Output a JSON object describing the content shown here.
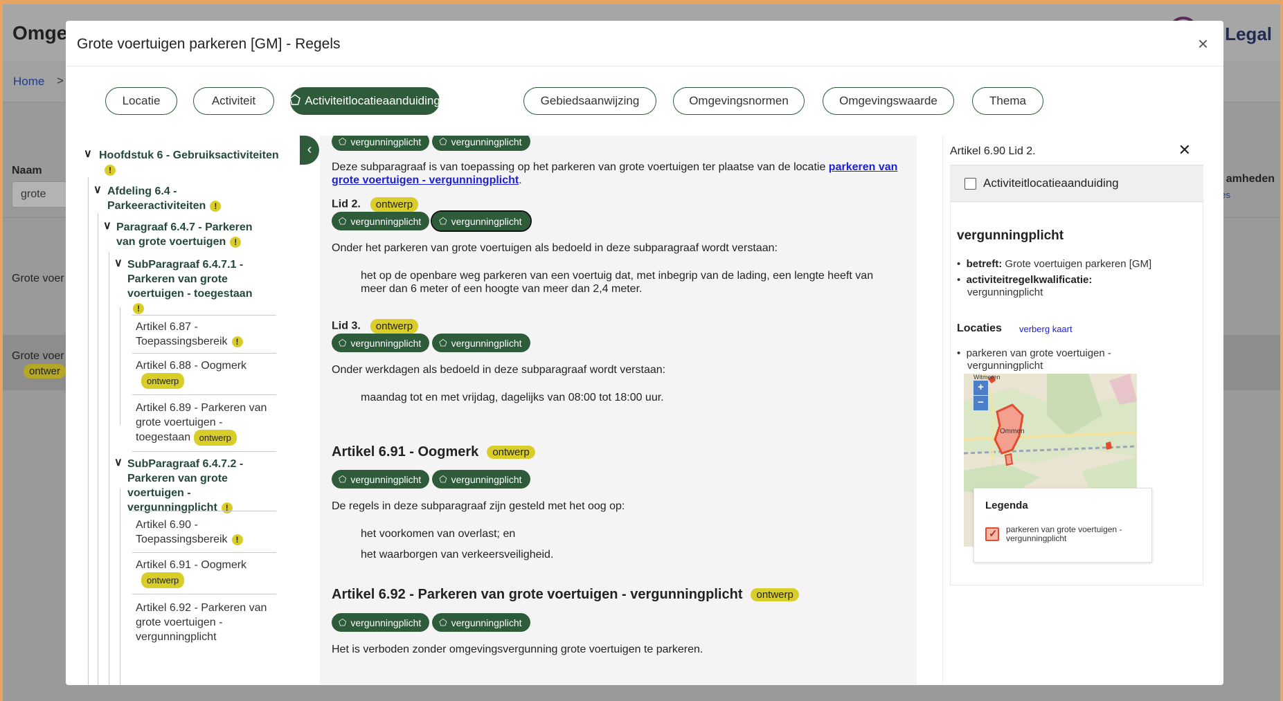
{
  "background": {
    "app_title": "Omgev",
    "brand": ".O Legal",
    "breadcrumb_home": "Home",
    "breadcrumb_sep": ">",
    "naam_label": "Naam",
    "naam_value": "grote",
    "right_text": "amheden",
    "right_link": "es",
    "row1_text": "Grote voer",
    "row2_text": "Grote voer",
    "row2_badge": "ontwer"
  },
  "modal": {
    "title": "Grote voertuigen parkeren [GM] - Regels",
    "close": "×"
  },
  "filters": [
    {
      "label": "Locatie",
      "active": false
    },
    {
      "label": "Activiteit",
      "active": false
    },
    {
      "label": "Activiteitlocatieaanduiding",
      "active": true
    },
    {
      "label": "Gebiedsaanwijzing",
      "active": false
    },
    {
      "label": "Omgevingsnormen",
      "active": false
    },
    {
      "label": "Omgevingswaarde",
      "active": false
    },
    {
      "label": "Thema",
      "active": false
    }
  ],
  "tree": {
    "h6": "Hoofdstuk 6 - Gebruiksactiviteiten",
    "afd_line1": "Afdeling 6.4 -",
    "afd_line2": "Parkeeractiviteiten",
    "par_line1": "Paragraaf 6.4.7 - Parkeren",
    "par_line2": "van grote voertuigen",
    "sub1_line1": "SubParagraaf 6.4.7.1 -",
    "sub1_line2": "Parkeren van grote",
    "sub1_line3": "voertuigen - toegestaan",
    "a687_line1": "Artikel 6.87 -",
    "a687_line2": "Toepassingsbereik",
    "a688_line1": "Artikel 6.88 - Oogmerk",
    "a689_line1": "Artikel 6.89 - Parkeren van",
    "a689_line2": "grote voertuigen -",
    "a689_line3": "toegestaan",
    "sub2_line1": "SubParagraaf 6.4.7.2 -",
    "sub2_line2": "Parkeren van grote",
    "sub2_line3": "voertuigen -",
    "sub2_line4": "vergunningplicht",
    "a690_line1": "Artikel 6.90 -",
    "a690_line2": "Toepassingsbereik",
    "a691_line1": "Artikel 6.91 - Oogmerk",
    "a692_line1": "Artikel 6.92 - Parkeren van",
    "a692_line2": "grote voertuigen -",
    "a692_line3": "vergunningplicht",
    "ontwerp": "ontwerp",
    "warn": "!"
  },
  "content": {
    "tag": "vergunningplicht",
    "p1_text": "Deze subparagraaf is van toepassing op het parkeren van grote voertuigen ter plaatse van de locatie ",
    "p1_link_a": "parkeren van",
    "p1_link_b": "grote voertuigen - vergunningplicht",
    "p1_end": ".",
    "lid2": "Lid 2.",
    "lid3": "Lid 3.",
    "ontwerp": "ontwerp",
    "lid2_intro": "Onder het parkeren van grote voertuigen als bedoeld in deze subparagraaf wordt verstaan:",
    "lid2_def_1": "het op de openbare weg parkeren van een voertuig dat, met inbegrip van de lading, een lengte heeft van",
    "lid2_def_2": "meer dan 6 meter of een hoogte van meer dan 2,4 meter.",
    "lid3_intro": "Onder werkdagen als bedoeld in deze subparagraaf wordt verstaan:",
    "lid3_def": "maandag tot en met vrijdag, dagelijks van 08:00 tot 18:00 uur.",
    "art691_title": "Artikel 6.91 - Oogmerk",
    "art691_intro": "De regels in deze subparagraaf zijn gesteld met het oog op:",
    "art691_item1": "het voorkomen van overlast; en",
    "art691_item2": "het waarborgen van verkeersveiligheid.",
    "art692_title": "Artikel 6.92 - Parkeren van grote voertuigen - vergunningplicht",
    "art692_text": "Het is verboden zonder omgevingsvergunning grote voertuigen te parkeren."
  },
  "right_panel": {
    "title": "Artikel 6.90 Lid 2.",
    "close": "✕",
    "checkbox_label": "Activiteitlocatieaanduiding",
    "heading": "vergunningplicht",
    "betreft_key": "betreft:",
    "betreft_val": " Grote voertuigen parkeren [GM]",
    "kwal_key": "activiteitregelkwalificatie:",
    "kwal_val": "vergunningplicht",
    "locaties": "Locaties",
    "verberg": "verberg kaart",
    "loc_item_1": "parkeren van grote voertuigen -",
    "loc_item_2": "vergunningplicht",
    "map_label_top": "Witmeren",
    "map_label_town": "Ommen",
    "zoom_in": "+",
    "zoom_out": "−",
    "legend_title": "Legenda",
    "legend_item": "parkeren van grote voertuigen - vergunningplicht"
  },
  "colors": {
    "accent_green": "#2e5b3a",
    "badge_yellow": "#d9cd2a",
    "link_blue": "#1b1fd9",
    "map_red": "#e34b2f"
  }
}
